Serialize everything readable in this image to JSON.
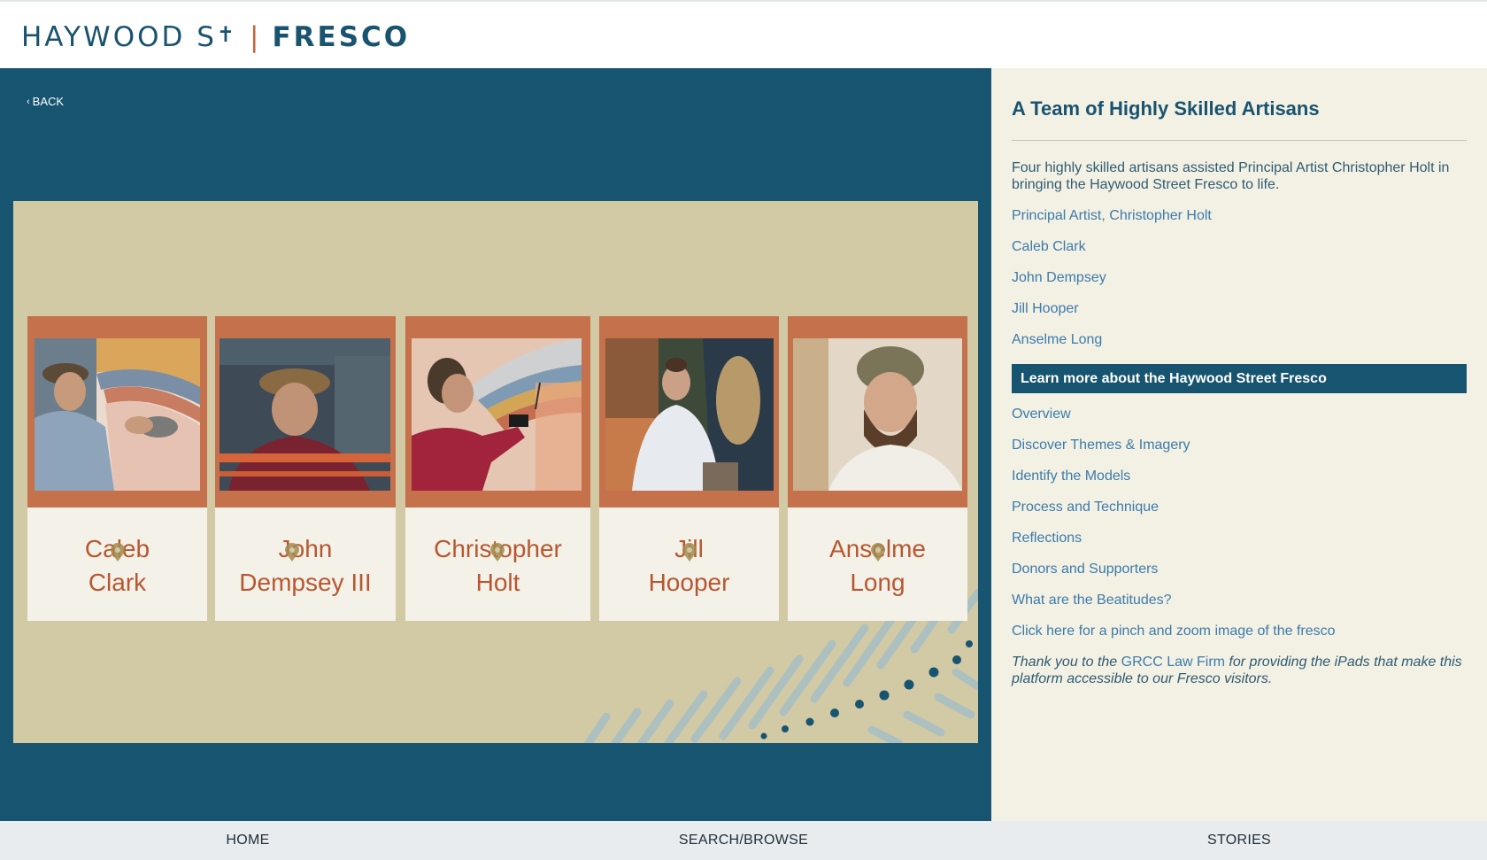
{
  "header": {
    "logo_left": "HAYWOOD S",
    "logo_cross": "✝",
    "logo_sep": "|",
    "logo_right": "FRESCO"
  },
  "main": {
    "back_label": "BACK",
    "cards": [
      {
        "first": "Caleb",
        "last": "Clark"
      },
      {
        "first": "John",
        "last": "Dempsey III"
      },
      {
        "first": "Christopher",
        "last": "Holt"
      },
      {
        "first": "Jill",
        "last": "Hooper"
      },
      {
        "first": "Anselme",
        "last": "Long"
      }
    ]
  },
  "sidebar": {
    "title": "A Team of Highly Skilled Artisans",
    "intro": "Four highly skilled artisans assisted Principal Artist Christopher Holt in bringing the Haywood Street Fresco to life.",
    "artisan_links": [
      "Principal Artist, Christopher Holt",
      "Caleb Clark",
      "John Dempsey",
      "Jill Hooper",
      "Anselme Long"
    ],
    "banner": "Learn more about the Haywood Street Fresco",
    "learn_links": [
      "Overview",
      "Discover Themes & Imagery",
      "Identify the Models",
      "Process and Technique",
      "Reflections",
      "Donors and Supporters",
      "What are the Beatitudes?",
      "Click here for a pinch and zoom image of the fresco"
    ],
    "thanks_pre": "Thank you to the ",
    "thanks_link": "GRCC Law Firm",
    "thanks_post": " for providing the iPads that make this platform accessible to our Fresco visitors."
  },
  "footer": {
    "nav": [
      "HOME",
      "SEARCH/BROWSE",
      "STORIES"
    ]
  },
  "colors": {
    "brand_teal": "#175470",
    "accent_rust": "#c5714b",
    "panel_tan": "#d2c9a5",
    "sidebar_bg": "#f3f0e4",
    "link_blue": "#3c7cab"
  }
}
